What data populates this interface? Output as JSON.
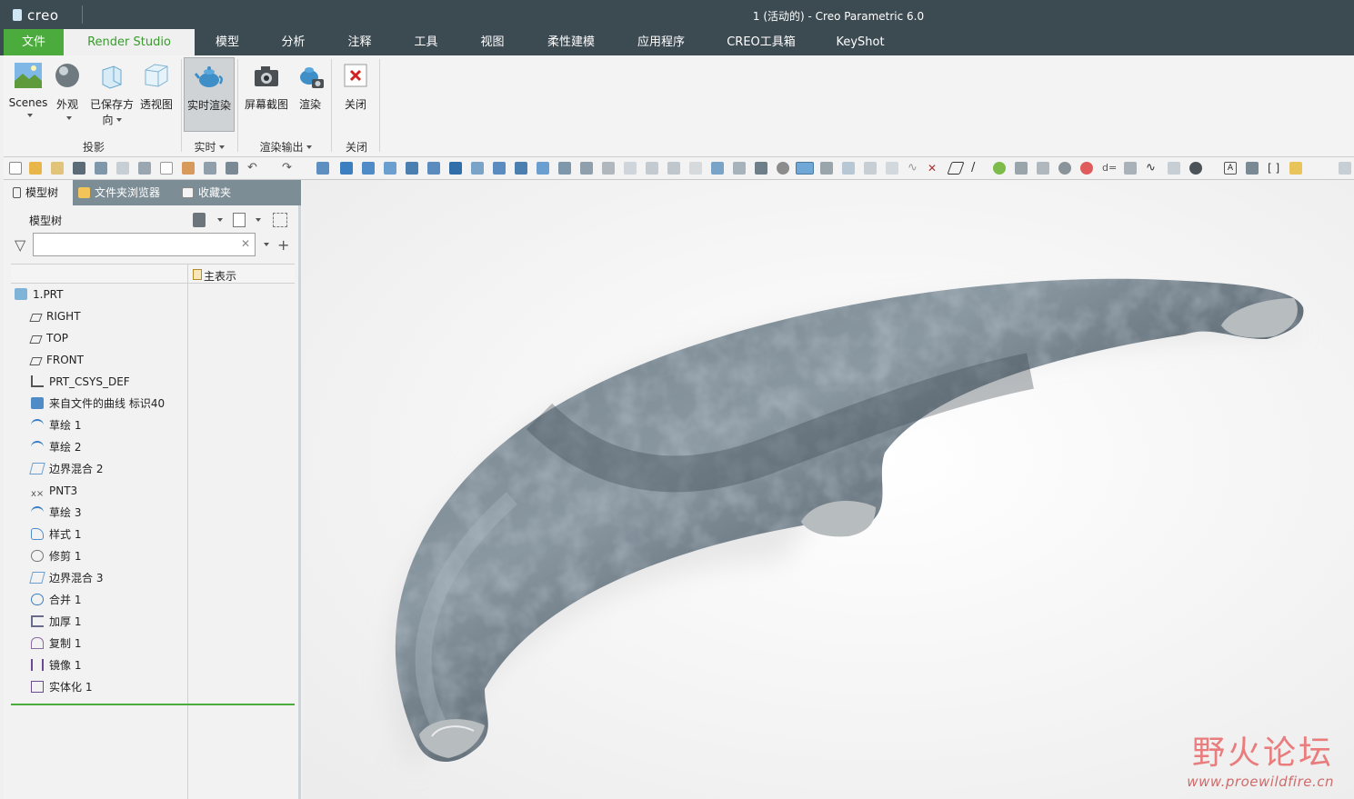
{
  "window": {
    "logo": "creo",
    "title": "1 (活动的) - Creo Parametric 6.0"
  },
  "tabs": [
    {
      "label": "文件"
    },
    {
      "label": "Render Studio"
    },
    {
      "label": "模型"
    },
    {
      "label": "分析"
    },
    {
      "label": "注释"
    },
    {
      "label": "工具"
    },
    {
      "label": "视图"
    },
    {
      "label": "柔性建模"
    },
    {
      "label": "应用程序"
    },
    {
      "label": "CREO工具箱"
    },
    {
      "label": "KeyShot"
    }
  ],
  "ribbon": {
    "scenes": "Scenes",
    "appearance": "外观",
    "saved_orient_1": "已保存方",
    "saved_orient_2": "向",
    "perspective": "透视图",
    "realtime_render": "实时渲染",
    "screenshot": "屏幕截图",
    "render": "渲染",
    "close": "关闭",
    "group_projection": "投影",
    "group_realtime": "实时",
    "group_output": "渲染输出",
    "group_close": "关闭"
  },
  "panel_tabs": {
    "model_tree": "模型树",
    "folder_browser": "文件夹浏览器",
    "favorites": "收藏夹"
  },
  "model_tree": {
    "title": "模型树",
    "filter_placeholder": "",
    "column_header": "主表示",
    "items": [
      {
        "label": "1.PRT"
      },
      {
        "label": "RIGHT"
      },
      {
        "label": "TOP"
      },
      {
        "label": "FRONT"
      },
      {
        "label": "PRT_CSYS_DEF"
      },
      {
        "label": "来自文件的曲线 标识40"
      },
      {
        "label": "草绘 1"
      },
      {
        "label": "草绘 2"
      },
      {
        "label": "边界混合 2"
      },
      {
        "label": "PNT3"
      },
      {
        "label": "草绘 3"
      },
      {
        "label": "样式 1"
      },
      {
        "label": "修剪 1"
      },
      {
        "label": "边界混合 3"
      },
      {
        "label": "合并 1"
      },
      {
        "label": "加厚 1"
      },
      {
        "label": "复制 1"
      },
      {
        "label": "镜像 1"
      },
      {
        "label": "实体化 1"
      }
    ]
  },
  "watermark": {
    "cn": "野火论坛",
    "url": "www.proewildfire.cn"
  },
  "colors": {
    "title_bar": "#3c4a52",
    "file_tab": "#4bab3d",
    "active_tab_text": "#3a9a2e"
  }
}
